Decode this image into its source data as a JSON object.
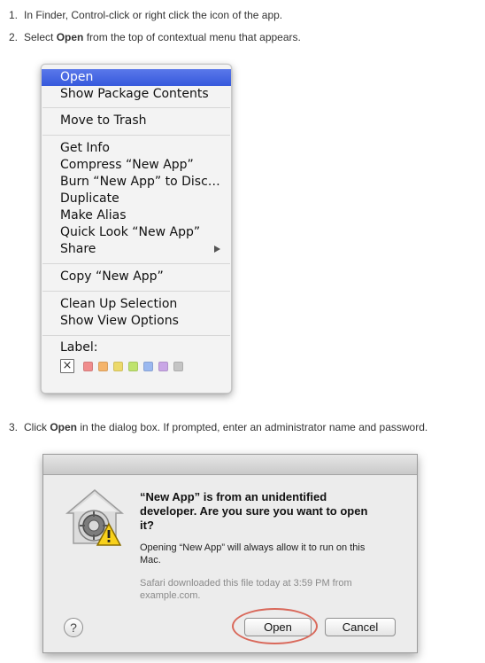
{
  "steps": [
    {
      "number": "1.",
      "before": "In Finder, Control-click or right click the icon of the app.",
      "bold": "",
      "after": ""
    },
    {
      "number": "2.",
      "before": "Select ",
      "bold": "Open",
      "after": " from the top of contextual menu that appears."
    },
    {
      "number": "3.",
      "before": "Click ",
      "bold": "Open",
      "after": " in the dialog box. If prompted, enter an administrator name and password."
    }
  ],
  "context_menu": {
    "items": [
      {
        "label": "Open",
        "selected": true
      },
      {
        "label": "Show Package Contents"
      },
      {
        "label": "Move to Trash"
      },
      {
        "label": "Get Info"
      },
      {
        "label": "Compress “New App”"
      },
      {
        "label": "Burn “New App” to Disc…"
      },
      {
        "label": "Duplicate"
      },
      {
        "label": "Make Alias"
      },
      {
        "label": "Quick Look “New App”"
      },
      {
        "label": "Share",
        "submenu": true
      },
      {
        "label": "Copy “New App”"
      },
      {
        "label": "Clean Up Selection"
      },
      {
        "label": "Show View Options"
      }
    ],
    "label_title": "Label:",
    "label_none_glyph": "×",
    "label_colors": [
      "#f08c8c",
      "#f5b46a",
      "#ecd96a",
      "#bfe36e",
      "#9ab8f0",
      "#c9a6e6",
      "#c4c4c4"
    ],
    "selection_color": "#3f62e0"
  },
  "dialog": {
    "heading": "“New App” is from an unidentified developer. Are you sure you want to open it?",
    "body": "Opening “New App” will always allow it to run on this Mac.",
    "note": "Safari downloaded this file today at 3:59 PM from example.com.",
    "help_glyph": "?",
    "open_button": "Open",
    "cancel_button": "Cancel",
    "highlight_color": "#d9685a"
  }
}
